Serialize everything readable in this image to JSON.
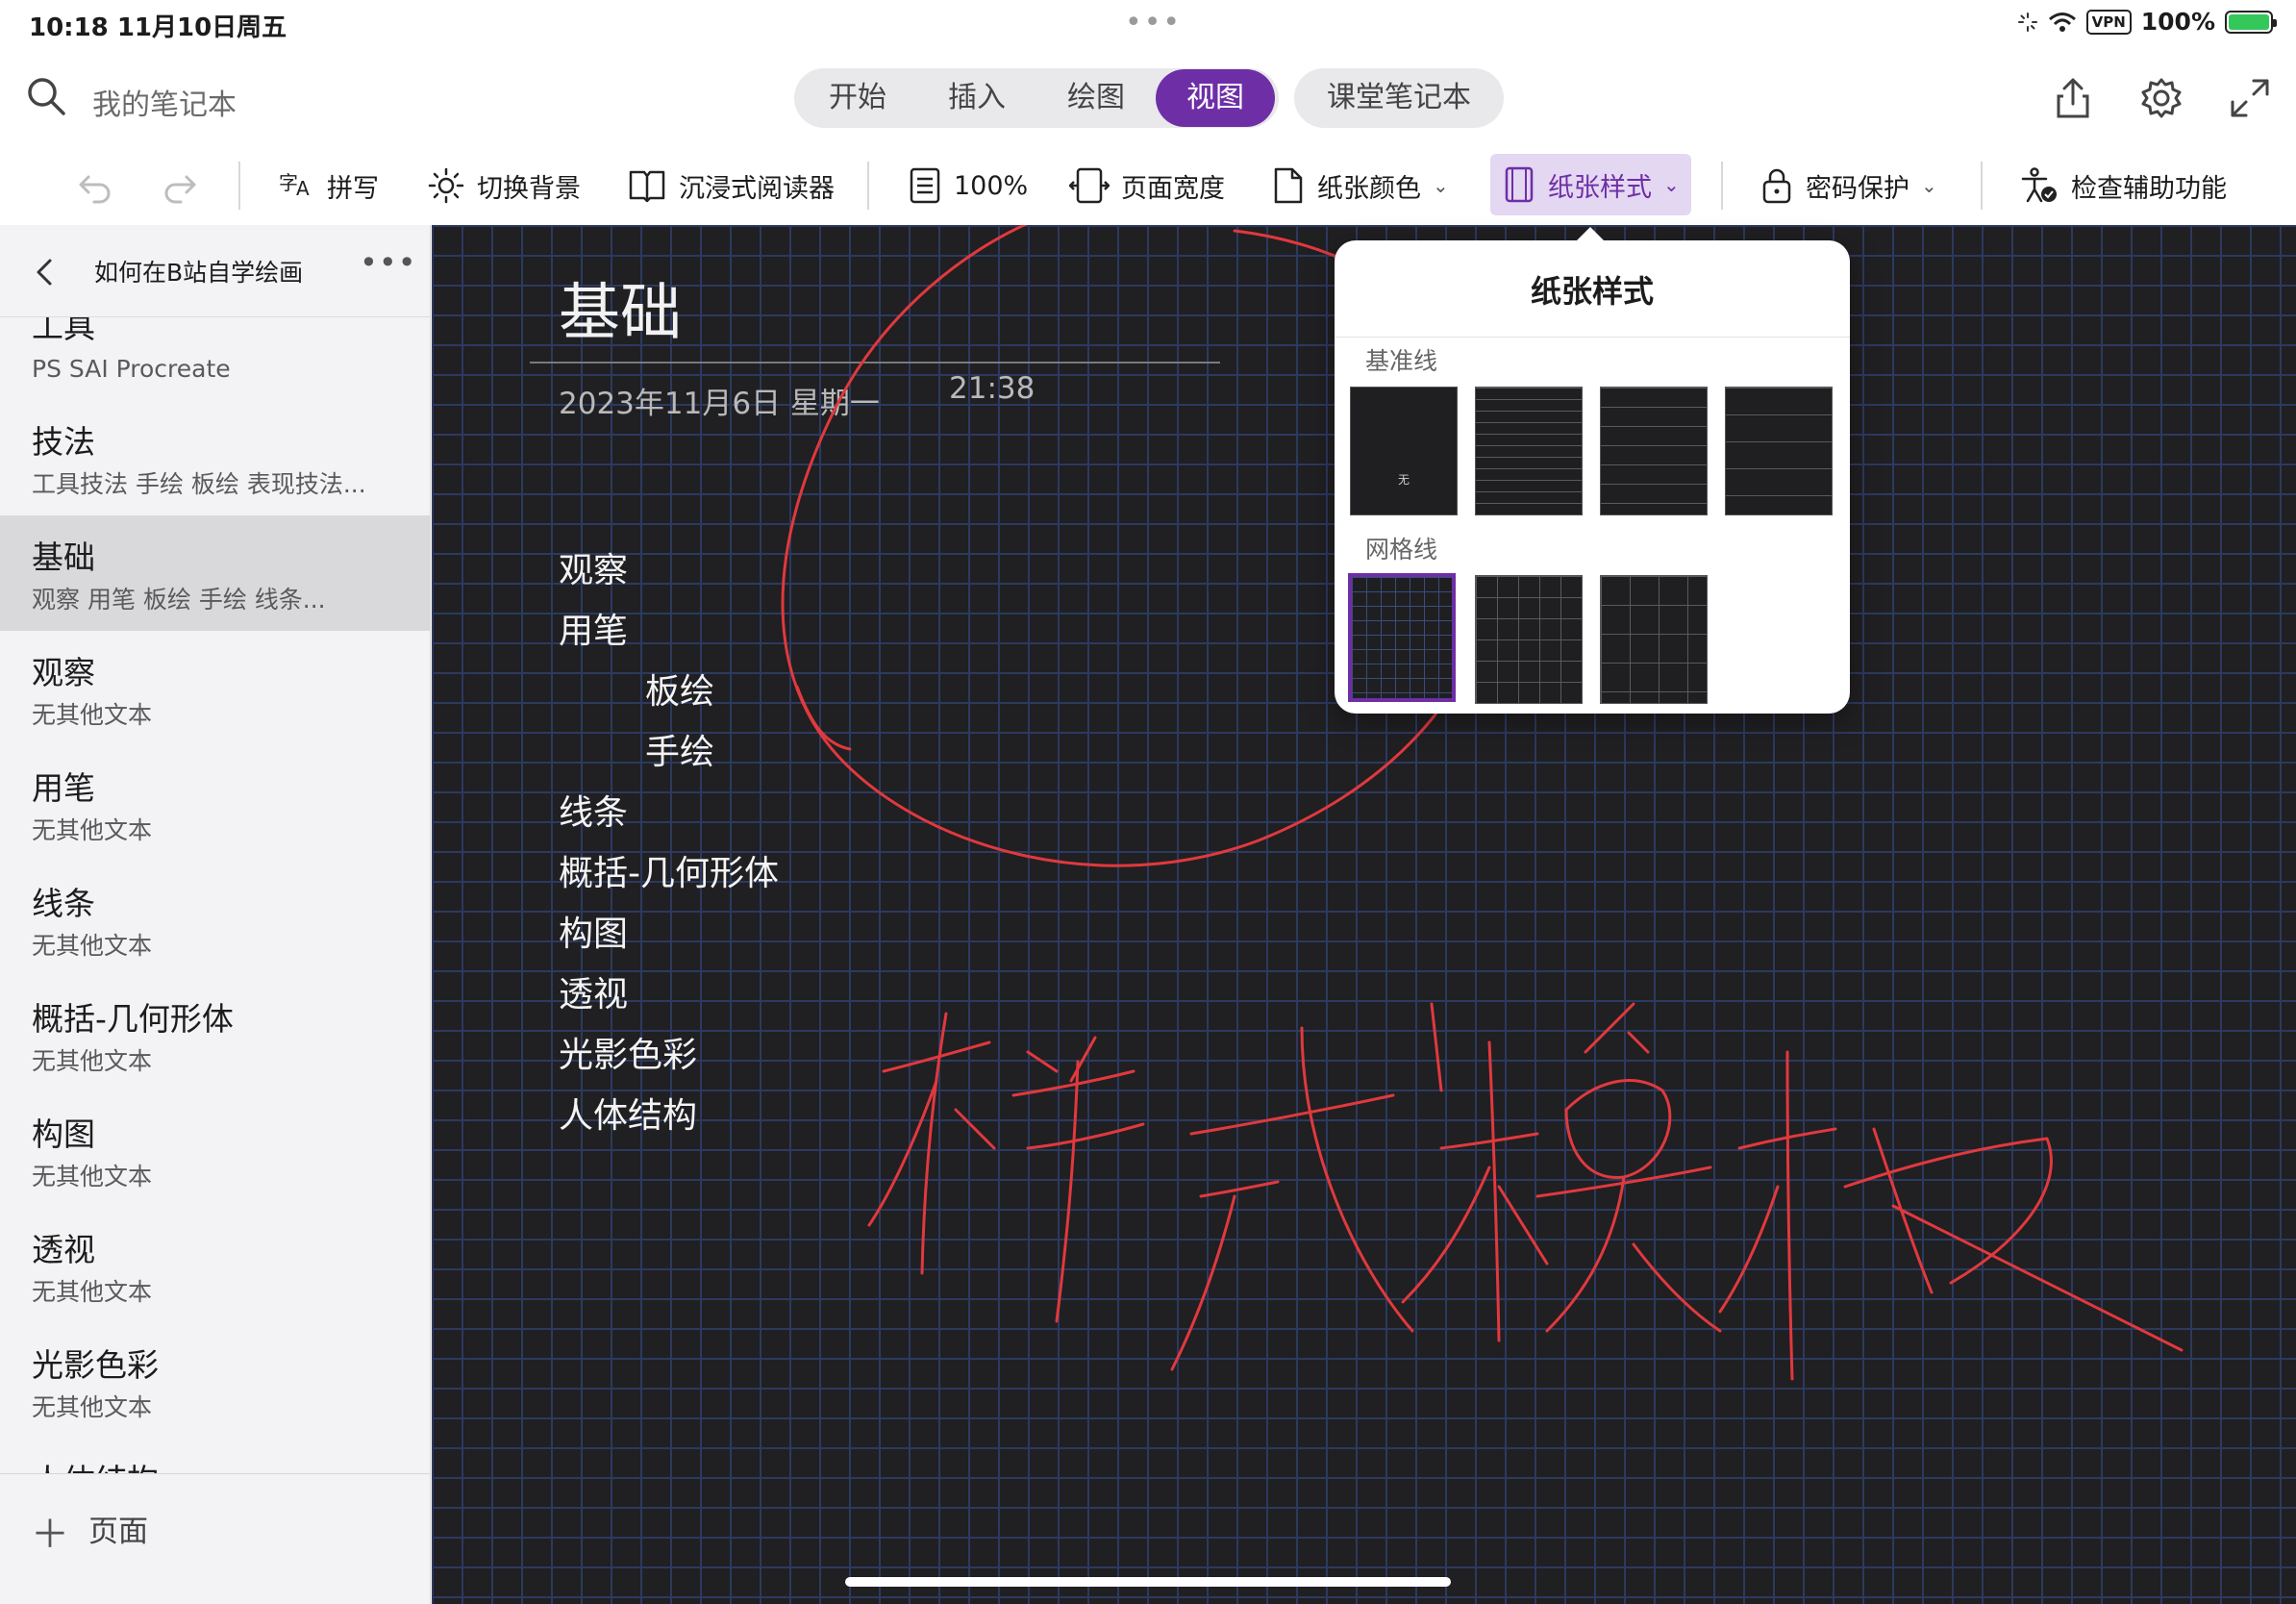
{
  "status_bar": {
    "time": "10:18  11月10日周五",
    "dots": "•••",
    "vpn": "VPN",
    "battery": "100%"
  },
  "header": {
    "search_placeholder": "我的笔记本",
    "tabs": [
      {
        "label": "开始",
        "active": false
      },
      {
        "label": "插入",
        "active": false
      },
      {
        "label": "绘图",
        "active": false
      },
      {
        "label": "视图",
        "active": true
      }
    ],
    "class_notebook_tab": "课堂笔记本",
    "icons": [
      "share-icon",
      "settings-icon",
      "expand-icon"
    ]
  },
  "ribbon": {
    "spelling": "拼写",
    "switch_background": "切换背景",
    "immersive_reader": "沉浸式阅读器",
    "zoom": "100%",
    "page_width": "页面宽度",
    "paper_color": "纸张颜色",
    "paper_style": "纸张样式",
    "password": "密码保护",
    "accessibility": "检查辅助功能"
  },
  "sidebar": {
    "section_title": "如何在B站自学绘画",
    "more": "•••",
    "items": [
      {
        "title": "工具",
        "subtitle": "PS  SAI  Procreate",
        "selected": false
      },
      {
        "title": "技法",
        "subtitle": "工具技法  手绘  板绘  表现技法...",
        "selected": false
      },
      {
        "title": "基础",
        "subtitle": "观察  用笔  板绘  手绘  线条...",
        "selected": true
      },
      {
        "title": "观察",
        "subtitle": "无其他文本",
        "selected": false
      },
      {
        "title": "用笔",
        "subtitle": "无其他文本",
        "selected": false
      },
      {
        "title": "线条",
        "subtitle": "无其他文本",
        "selected": false
      },
      {
        "title": "概括-几何形体",
        "subtitle": "无其他文本",
        "selected": false
      },
      {
        "title": "构图",
        "subtitle": "无其他文本",
        "selected": false
      },
      {
        "title": "透视",
        "subtitle": "无其他文本",
        "selected": false
      },
      {
        "title": "光影色彩",
        "subtitle": "无其他文本",
        "selected": false
      },
      {
        "title": "人体结构",
        "subtitle": "",
        "selected": false
      }
    ],
    "add_page_label": "页面"
  },
  "page": {
    "title": "基础",
    "date": "2023年11月6日 星期一",
    "time": "21:38",
    "outline": [
      {
        "text": "观察",
        "indent": false
      },
      {
        "text": "用笔",
        "indent": false
      },
      {
        "text": "板绘",
        "indent": true
      },
      {
        "text": "手绘",
        "indent": true
      },
      {
        "text": "线条",
        "indent": false
      },
      {
        "text": "概括-几何形体",
        "indent": false
      },
      {
        "text": "构图",
        "indent": false
      },
      {
        "text": "透视",
        "indent": false
      },
      {
        "text": "光影色彩",
        "indent": false
      },
      {
        "text": "人体结构",
        "indent": false
      }
    ]
  },
  "popover": {
    "title": "纸张样式",
    "rule_lines_label": "基准线",
    "grid_lines_label": "网格线",
    "none_label": "无"
  },
  "colors": {
    "accent": "#6e2fa6",
    "ink": "#e0393e",
    "canvas": "#201f22",
    "grid": "#2c3a5f"
  }
}
